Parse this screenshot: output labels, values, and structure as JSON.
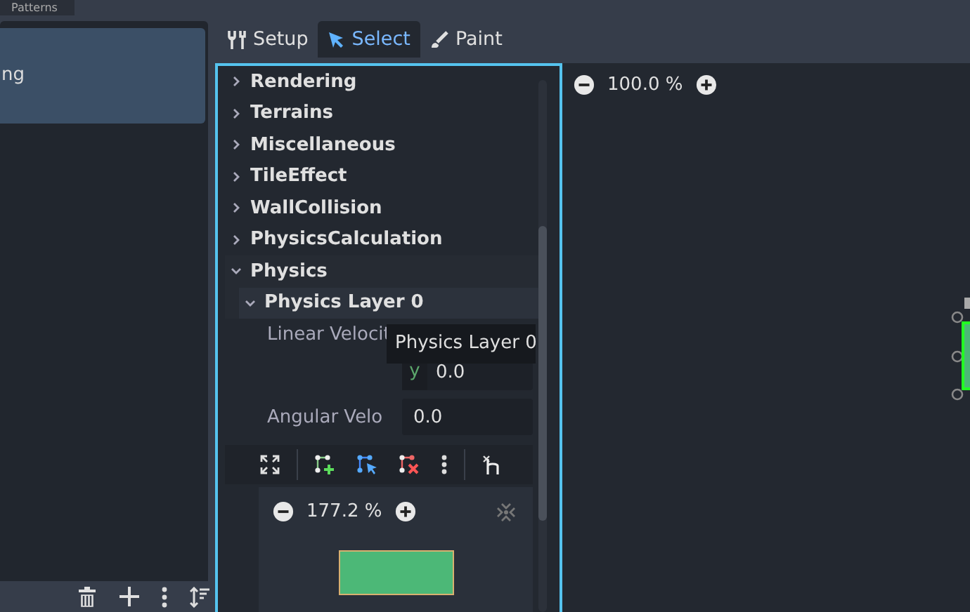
{
  "top_tabs": [
    {
      "label": "Patterns",
      "selected": false
    }
  ],
  "left_list": {
    "items": [
      {
        "label": "ng",
        "selected": true
      }
    ]
  },
  "mode_tabs": [
    {
      "label": "Setup",
      "kind": "setup",
      "selected": false
    },
    {
      "label": "Select",
      "kind": "select",
      "selected": true
    },
    {
      "label": "Paint",
      "kind": "paint",
      "selected": false
    }
  ],
  "inspector": {
    "tree": [
      {
        "label": "Rendering",
        "expanded": false
      },
      {
        "label": "Terrains",
        "expanded": false
      },
      {
        "label": "Miscellaneous",
        "expanded": false
      },
      {
        "label": "TileEffect",
        "expanded": false
      },
      {
        "label": "WallCollision",
        "expanded": false
      },
      {
        "label": "PhysicsCalculation",
        "expanded": false
      },
      {
        "label": "Physics",
        "expanded": true,
        "children": [
          {
            "label": "Physics Layer 0",
            "expanded": true
          }
        ]
      }
    ],
    "properties": [
      {
        "label": "Linear Velocit",
        "fields": [
          {
            "axis": "y",
            "value": "0.0"
          }
        ]
      },
      {
        "label": "Angular Velo",
        "fields": [
          {
            "value": "0.0"
          }
        ]
      }
    ],
    "tooltip": "Physics Layer 0",
    "atlas": {
      "zoom": "177.2 %"
    }
  },
  "canvas": {
    "zoom": "100.0 %"
  }
}
